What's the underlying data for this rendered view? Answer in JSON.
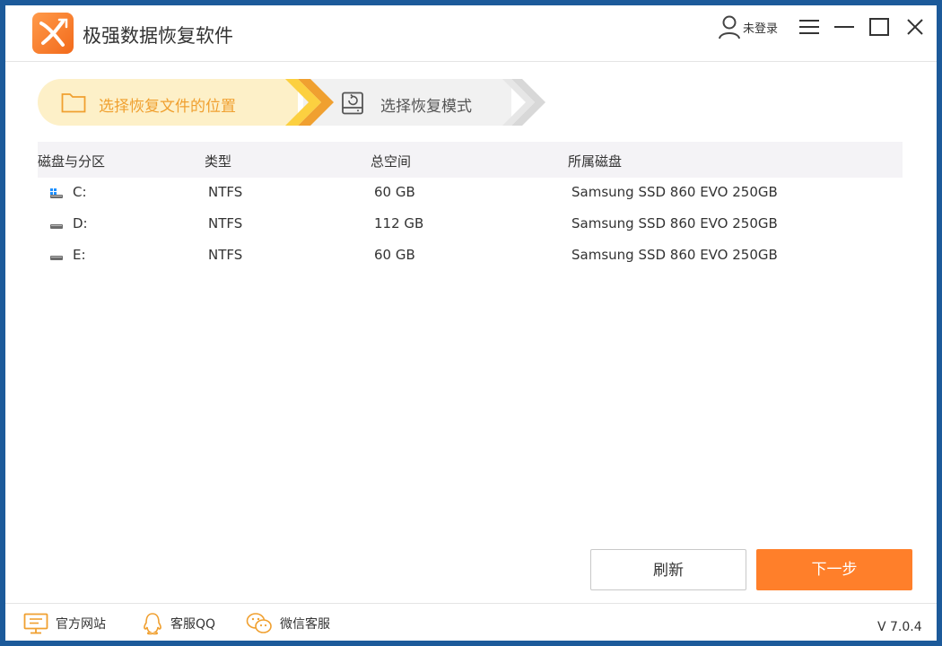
{
  "app": {
    "title": "极强数据恢复软件"
  },
  "header": {
    "login_label": "未登录"
  },
  "steps": [
    {
      "label": "选择恢复文件的位置",
      "active": true
    },
    {
      "label": "选择恢复模式",
      "active": false
    }
  ],
  "table": {
    "columns": [
      "磁盘与分区",
      "类型",
      "总空间",
      "所属磁盘"
    ],
    "rows": [
      {
        "partition": "C:",
        "type": "NTFS",
        "size": "60 GB",
        "disk": "Samsung SSD 860 EVO 250GB",
        "icon": "system-drive-icon"
      },
      {
        "partition": "D:",
        "type": "NTFS",
        "size": "112 GB",
        "disk": "Samsung SSD 860 EVO 250GB",
        "icon": "drive-icon"
      },
      {
        "partition": "E:",
        "type": "NTFS",
        "size": "60 GB",
        "disk": "Samsung SSD 860 EVO 250GB",
        "icon": "drive-icon"
      }
    ]
  },
  "buttons": {
    "refresh": "刷新",
    "next": "下一步"
  },
  "footer": {
    "website": "官方网站",
    "qq": "客服QQ",
    "wechat": "微信客服",
    "version": "V 7.0.4"
  },
  "colors": {
    "accent": "#ff7f2a",
    "step_active_bg": "#fdf0c8",
    "step_active_text": "#f0a030"
  }
}
